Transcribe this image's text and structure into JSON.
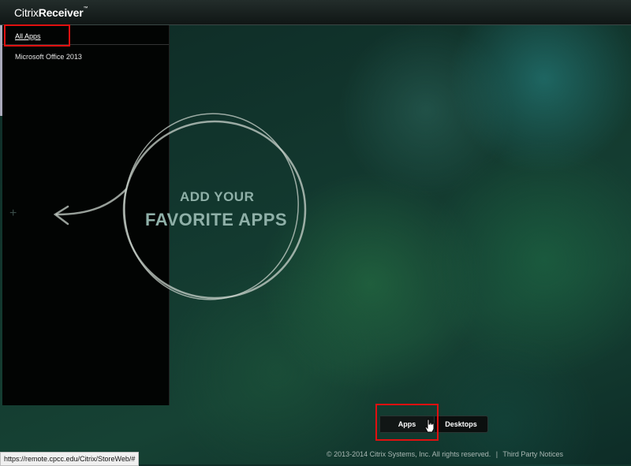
{
  "header": {
    "brand_citrix": "Citrix",
    "brand_receiver": "Receiver",
    "trademark": "™"
  },
  "sidebar": {
    "all_apps": "All Apps",
    "items": [
      {
        "label": "Microsoft Office 2013"
      }
    ]
  },
  "main": {
    "hero_line1": "ADD YOUR",
    "hero_line2": "FAVORITE APPS",
    "plus": "+"
  },
  "toggle": {
    "apps": "Apps",
    "desktops": "Desktops",
    "selected": "Apps"
  },
  "footer": {
    "copyright": "© 2013-2014 Citrix Systems, Inc. All rights reserved.",
    "separator": "|",
    "notices": "Third Party Notices"
  },
  "statusbar": {
    "url": "https://remote.cpcc.edu/Citrix/StoreWeb/#"
  },
  "colors": {
    "highlight": "#e01010",
    "background": "#12372e",
    "hero_text": "#8fb0a8"
  }
}
